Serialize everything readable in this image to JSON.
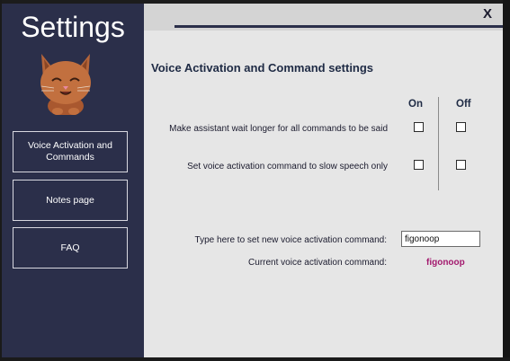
{
  "sidebar": {
    "title": "Settings",
    "items": [
      {
        "label": "Voice Activation and Commands"
      },
      {
        "label": "Notes page"
      },
      {
        "label": "FAQ"
      }
    ]
  },
  "window": {
    "close_label": "X"
  },
  "main": {
    "section_title": "Voice Activation and Command settings",
    "columns": {
      "on": "On",
      "off": "Off"
    },
    "rows": [
      {
        "label": "Make assistant wait longer for all commands to be said",
        "on": false,
        "off": false
      },
      {
        "label": "Set voice activation command to slow speech only",
        "on": false,
        "off": false
      }
    ],
    "command_input": {
      "label": "Type here to set new voice activation command:",
      "value": "figonoop"
    },
    "current_command": {
      "label": "Current voice activation command:",
      "value": "figonoop",
      "color": "#a3196e"
    }
  },
  "colors": {
    "sidebar_bg": "#2b2f4a",
    "main_bg": "#e6e6e6",
    "accent": "#a3196e"
  }
}
